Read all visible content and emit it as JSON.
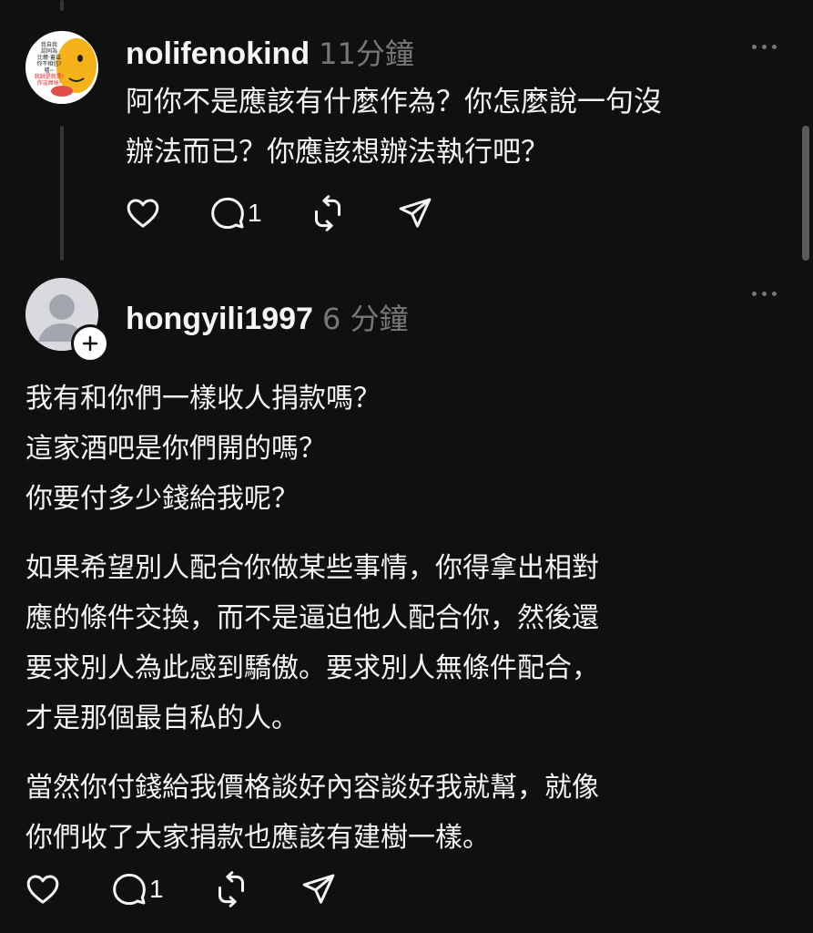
{
  "post1": {
    "username": "nolifenokind",
    "time": "11分鐘",
    "lines": [
      "阿你不是應該有什麼作為？你怎麼說一句沒",
      "辦法而已？你應該想辦法執行吧？"
    ],
    "reply_count": "1",
    "avatar_texts": [
      "我自我",
      "認同為",
      "比爾·蓋茲",
      "你不相信?",
      "嘘~",
      "我說是就是!",
      "你這屌絲!"
    ]
  },
  "post2": {
    "username": "hongyili1997",
    "time": "6 分鐘",
    "paragraphs": [
      [
        "我有和你們一樣收人捐款嗎？",
        "這家酒吧是你們開的嗎？",
        "你要付多少錢給我呢？"
      ],
      [
        "如果希望別人配合你做某些事情，你得拿出相對",
        "應的條件交換，而不是逼迫他人配合你，然後還",
        "要求別人為此感到驕傲。要求別人無條件配合，",
        "才是那個最自私的人。"
      ],
      [
        "當然你付錢給我價格談好內容談好我就幫，就像",
        "你們收了大家捐款也應該有建樹一樣。"
      ]
    ],
    "reply_count": "1"
  },
  "icons": [
    "heart-icon",
    "comment-icon",
    "repost-icon",
    "share-icon",
    "more-icon",
    "follow-plus-icon"
  ],
  "colors": {
    "background": "#101010",
    "text": "#f3f5f7",
    "muted": "#777777",
    "thread_line": "#333638"
  }
}
